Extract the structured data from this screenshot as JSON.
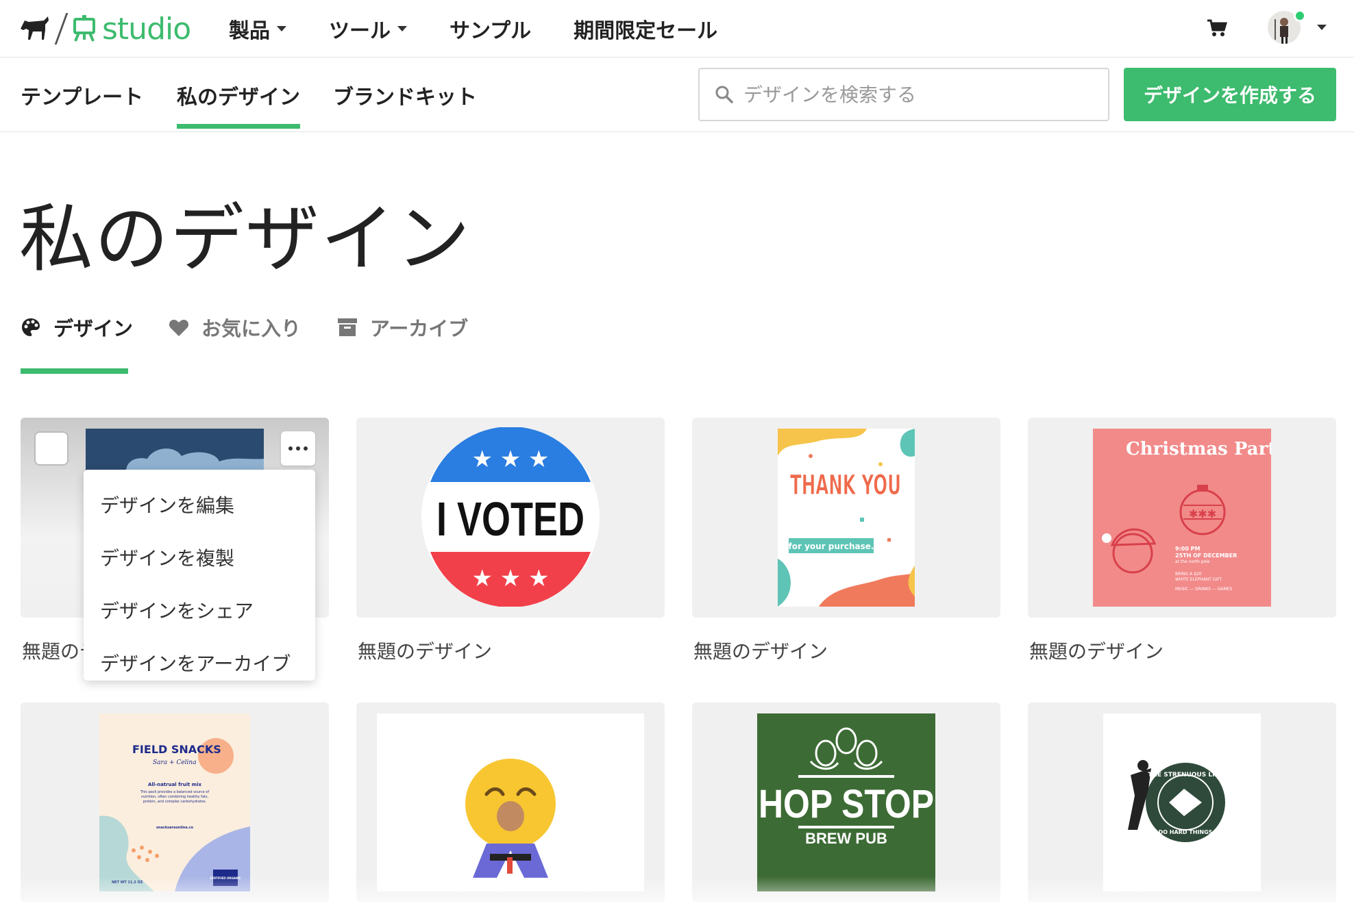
{
  "brand": {
    "name": "studio",
    "accent": "#3dbb6e"
  },
  "topnav": [
    {
      "label": "製品",
      "dropdown": true
    },
    {
      "label": "ツール",
      "dropdown": true
    },
    {
      "label": "サンプル",
      "dropdown": false
    },
    {
      "label": "期間限定セール",
      "dropdown": false
    }
  ],
  "subnav": {
    "tabs": [
      "テンプレート",
      "私のデザイン",
      "ブランドキット"
    ],
    "active": "私のデザイン",
    "search_placeholder": "デザインを検索する",
    "create_label": "デザインを作成する"
  },
  "page_title": "私のデザイン",
  "design_tabs": [
    {
      "label": "デザイン",
      "icon": "palette-icon",
      "active": true
    },
    {
      "label": "お気に入り",
      "icon": "heart-icon",
      "active": false
    },
    {
      "label": "アーカイブ",
      "icon": "archive-icon",
      "active": false
    }
  ],
  "context_menu": [
    "デザインを編集",
    "デザインを複製",
    "デザインをシェア",
    "デザインをアーカイブ"
  ],
  "designs": [
    {
      "label": "無題のデ",
      "thumb": "blue-clouds"
    },
    {
      "label": "無題のデザイン",
      "thumb": "i-voted",
      "text": "I VOTED"
    },
    {
      "label": "無題のデザイン",
      "thumb": "thank-you",
      "text": "THANK YOU",
      "sub": "for your purchase."
    },
    {
      "label": "無題のデザイン",
      "thumb": "christmas",
      "text": "Christmas Party",
      "lines": [
        "9:00 PM",
        "25TH OF DECEMBER",
        "at the north pole",
        "BRING A $20",
        "WHITE ELEPHANT GIFT",
        "MUSIC — DRINKS — GAMES"
      ]
    },
    {
      "thumb": "field-snacks",
      "text": "FIELD SNACKS",
      "script": "Sara + Celina",
      "sub": "All-natrual fruit mix",
      "lines": [
        "This pack provides a balanced source of",
        "nutrition, often combining healthy fats,",
        "protein, and complex carbohydrates."
      ],
      "site": "snacksareonline.co",
      "net": "NET WT 11.2 OZ",
      "badge": "CERTIFIED ORGANIC"
    },
    {
      "thumb": "emoji"
    },
    {
      "thumb": "hop-stop",
      "text": "HOP STOP",
      "sub": "BREW PUB"
    },
    {
      "thumb": "strenuous",
      "text": "THE STRENUOUS LIFE",
      "sub": "DO HARD THINGS"
    }
  ]
}
